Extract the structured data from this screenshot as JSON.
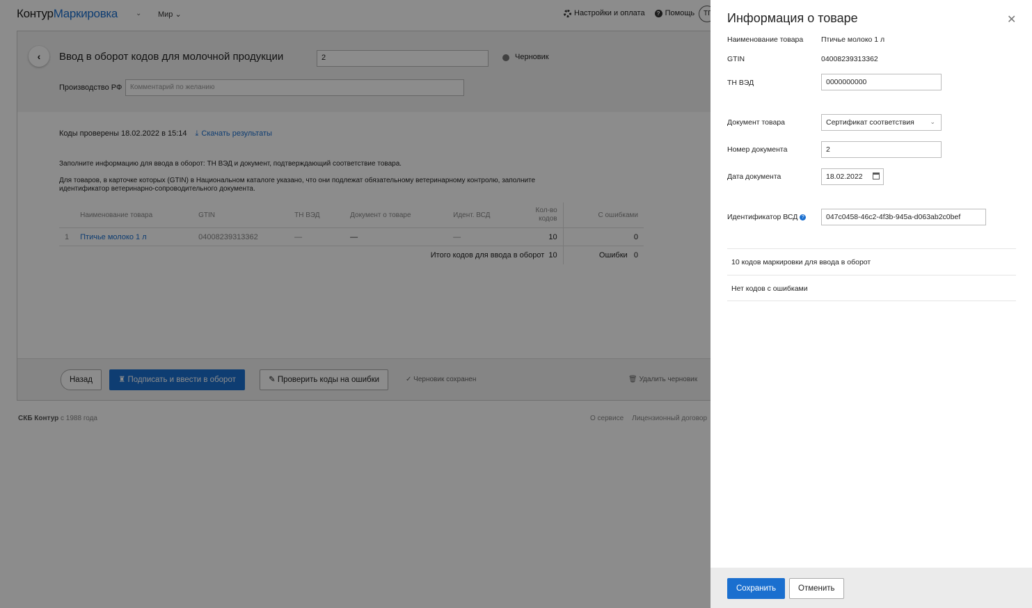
{
  "header": {
    "brand": "Контур",
    "product": "Маркировка",
    "org": "Мир",
    "settings": "Настройки и оплата",
    "help": "Помощь",
    "avatar": "ТГ"
  },
  "document": {
    "title": "Ввод в оборот кодов для молочной продукции",
    "number": "2",
    "status": "Черновик",
    "production_label": "Производство РФ",
    "comment_placeholder": "Комментарий по желанию",
    "checked_text": "Коды проверены 18.02.2022 в 15:14",
    "download_link": "Скачать результаты",
    "info1": "Заполните информацию для ввода в оборот: ТН ВЭД и документ, подтверждающий соответствие товара.",
    "info2": "Для товаров, в карточке которых (GTIN) в Национальном каталоге указано, что они подлежат обязательному ветеринарному контролю, заполните идентификатор ветеринарно-сопроводительного документа."
  },
  "table": {
    "headers": [
      "Наименование товара",
      "GTIN",
      "ТН ВЭД",
      "Документ о товаре",
      "Идент. ВСД",
      "Кол-во кодов",
      "С ошибками"
    ],
    "rows": [
      {
        "index": "1",
        "name": "Птичье молоко 1 л",
        "gtin": "04008239313362",
        "tnved": "—",
        "doc": "—",
        "vsd": "—",
        "qty": "10",
        "errors": "0"
      }
    ],
    "total_label": "Итого кодов для ввода в оборот",
    "total_value": "10",
    "errors_label": "Ошибки",
    "errors_value": "0"
  },
  "footer_actions": {
    "back": "Назад",
    "sign": "Подписать и ввести в оборот",
    "check": "Проверить коды на ошибки",
    "saved": "Черновик сохранен",
    "delete": "Удалить черновик"
  },
  "page_footer": {
    "company": "СКБ Контур",
    "since": "с 1988 года",
    "about": "О сервисе",
    "license": "Лицензионный договор"
  },
  "panel": {
    "title": "Информация о товаре",
    "name_label": "Наименование товара",
    "name_value": "Птичье молоко 1 л",
    "gtin_label": "GTIN",
    "gtin_value": "04008239313362",
    "tnved_label": "ТН ВЭД",
    "tnved_value": "0000000000",
    "doc_label": "Документ товара",
    "doc_value": "Сертификат соответствия",
    "docnum_label": "Номер документа",
    "docnum_value": "2",
    "docdate_label": "Дата документа",
    "docdate_value": "18.02.2022",
    "vsd_label": "Идентификатор ВСД",
    "vsd_value": "047c0458-46c2-4f3b-945a-d063ab2c0bef",
    "summary1": "10 кодов маркировки для ввода в оборот",
    "summary2": "Нет кодов с ошибками",
    "save": "Сохранить",
    "cancel": "Отменить"
  },
  "colors": {
    "accent": "#1a6fcf",
    "overlay": "rgba(0,0,0,0.45)"
  }
}
